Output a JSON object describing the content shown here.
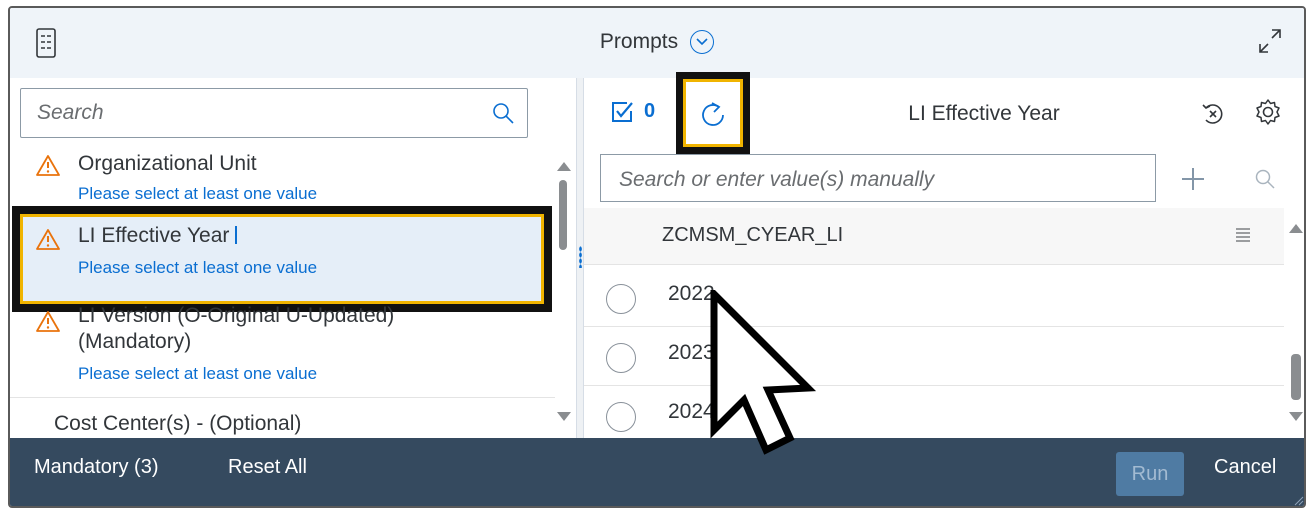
{
  "header": {
    "title": "Prompts"
  },
  "left": {
    "search_placeholder": "Search",
    "items": [
      {
        "title": "Organizational Unit",
        "sub": "Please select at least one value"
      },
      {
        "title": "LI Effective Year",
        "sub": "Please select at least one value"
      },
      {
        "title_line1": "LI Version (O-Original U-Updated)",
        "title_line2": "(Mandatory)",
        "sub": "Please select at least one value"
      },
      {
        "title": "Cost Center(s) - (Optional)"
      }
    ]
  },
  "right": {
    "selected_count": "0",
    "title": "LI Effective Year",
    "search_placeholder": "Search or enter value(s) manually",
    "column_header": "ZCMSM_CYEAR_LI",
    "rows": [
      "2022",
      "2023",
      "2024"
    ]
  },
  "footer": {
    "mandatory_label": "Mandatory (3)",
    "reset_label": "Reset All",
    "run_label": "Run",
    "cancel_label": "Cancel"
  },
  "colors": {
    "accent": "#0a6ed1",
    "warning": "#e9730c",
    "highlight": "#f0b400",
    "footer_bg": "#354a5f"
  },
  "icons": [
    "list-icon",
    "chevron-down-icon",
    "expand-icon",
    "search-icon",
    "warning-icon",
    "checkbox-icon",
    "refresh-icon",
    "clear-filter-icon",
    "gear-icon",
    "plus-icon",
    "menu-icon",
    "mouse-pointer-icon"
  ]
}
